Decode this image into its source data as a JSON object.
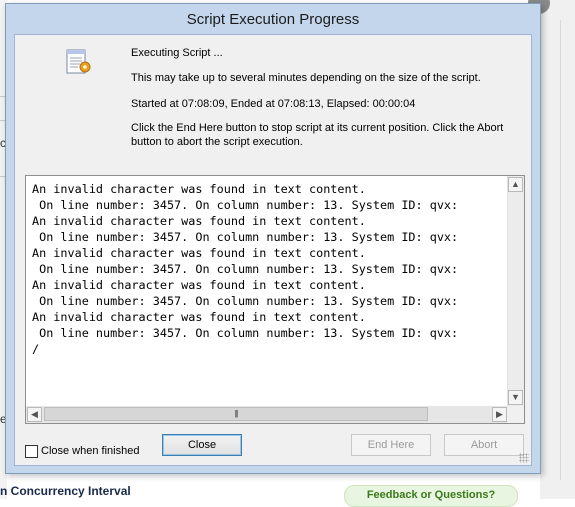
{
  "dialog": {
    "title": "Script Execution Progress",
    "status": "Executing Script ...",
    "note": "This may take up to several minutes depending on the size of the script.",
    "timing": "Started at 07:08:09, Ended at 07:08:13,  Elapsed: 00:00:04",
    "help": "Click the End Here button to stop script at its current position. Click the Abort button to abort the script execution.",
    "icon": "script-notepad-icon"
  },
  "log": {
    "lines": [
      "An invalid character was found in text content.",
      " On line number: 3457. On column number: 13. System ID: qvx:",
      "An invalid character was found in text content.",
      " On line number: 3457. On column number: 13. System ID: qvx:",
      "An invalid character was found in text content.",
      " On line number: 3457. On column number: 13. System ID: qvx:",
      "An invalid character was found in text content.",
      " On line number: 3457. On column number: 13. System ID: qvx:",
      "An invalid character was found in text content.",
      " On line number: 3457. On column number: 13. System ID: qvx:",
      "/"
    ]
  },
  "controls": {
    "close_when_finished_label": "Close when finished",
    "close_when_finished_checked": false,
    "close_label": "Close",
    "end_here_label": "End Here",
    "abort_label": "Abort"
  },
  "background": {
    "concurrency_label": "n Concurrency Interval",
    "feedback_label": "Feedback or Questions?",
    "left_chars": [
      "c",
      "e"
    ]
  }
}
